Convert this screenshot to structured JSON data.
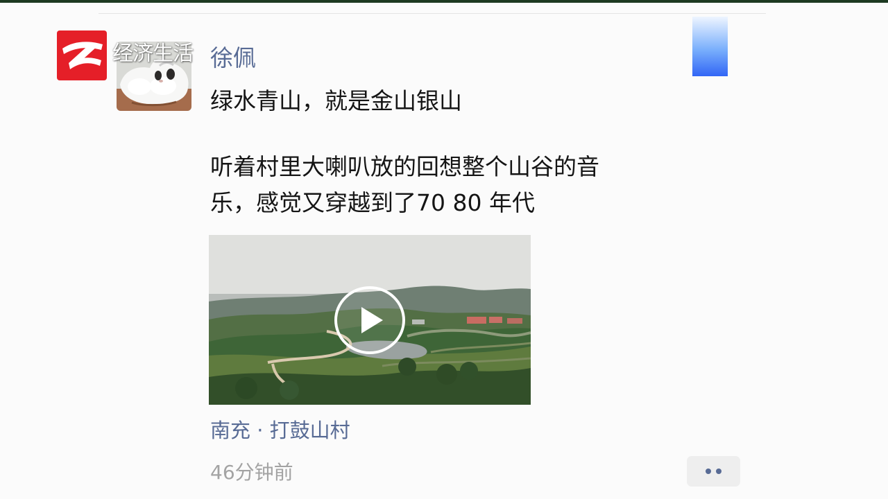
{
  "channel": {
    "name": "经济生活"
  },
  "post": {
    "author": "徐佩",
    "line1": "绿水青山，就是金山银山",
    "line2": "听着村里大喇叭放的回想整个山谷的音\n乐，感觉又穿越到了70 80 年代",
    "location": "南充 · 打鼓山村",
    "timestamp": "46分钟前"
  },
  "colors": {
    "name_link": "#586b95",
    "text": "#151515",
    "time": "#a3a3a3",
    "logo_red": "#e51f28",
    "accent_blue": "#3266f5"
  },
  "icons": {
    "play": "play-icon",
    "more": "more-icon",
    "logo": "zhejiang-tv-logo"
  }
}
